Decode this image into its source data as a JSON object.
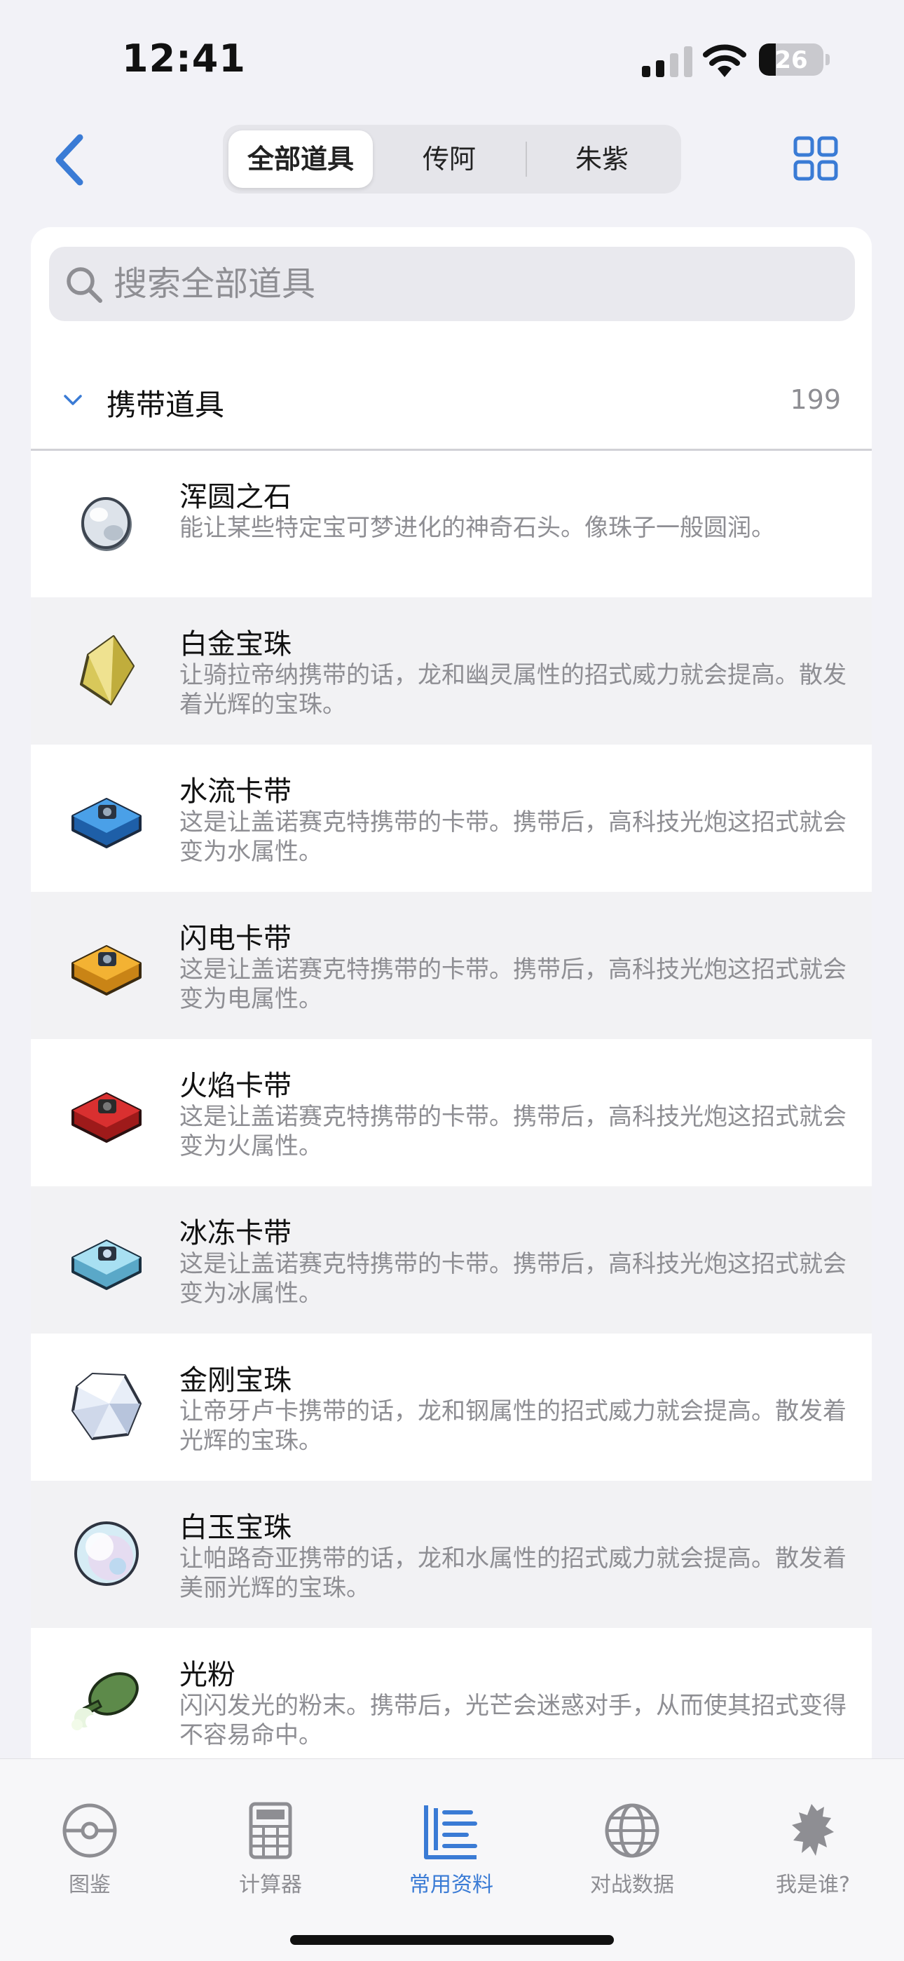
{
  "status_bar": {
    "time": "12:41",
    "battery": "26",
    "battery_level": 0.26
  },
  "nav": {
    "segments": [
      {
        "label": "全部道具",
        "active": true
      },
      {
        "label": "传阿",
        "active": false
      },
      {
        "label": "朱紫",
        "active": false
      }
    ]
  },
  "search": {
    "placeholder": "搜索全部道具",
    "value": ""
  },
  "section": {
    "title": "携带道具",
    "count": "199"
  },
  "items": [
    {
      "name": "浑圆之石",
      "desc": "能让某些特定宝可梦进化的神奇石头。像珠子一般圆润。",
      "icon": "oval-stone-icon"
    },
    {
      "name": "白金宝珠",
      "desc": "让骑拉帝纳携带的话，龙和幽灵属性的招式威力就会提高。散发着光辉的宝珠。",
      "icon": "griseous-orb-icon"
    },
    {
      "name": "水流卡带",
      "desc": "这是让盖诺赛克特携带的卡带。携带后，高科技光炮这招式就会变为水属性。",
      "icon": "douse-drive-icon"
    },
    {
      "name": "闪电卡带",
      "desc": "这是让盖诺赛克特携带的卡带。携带后，高科技光炮这招式就会变为电属性。",
      "icon": "shock-drive-icon"
    },
    {
      "name": "火焰卡带",
      "desc": "这是让盖诺赛克特携带的卡带。携带后，高科技光炮这招式就会变为火属性。",
      "icon": "burn-drive-icon"
    },
    {
      "name": "冰冻卡带",
      "desc": "这是让盖诺赛克特携带的卡带。携带后，高科技光炮这招式就会变为冰属性。",
      "icon": "chill-drive-icon"
    },
    {
      "name": "金刚宝珠",
      "desc": "让帝牙卢卡携带的话，龙和钢属性的招式威力就会提高。散发着光辉的宝珠。",
      "icon": "adamant-orb-icon"
    },
    {
      "name": "白玉宝珠",
      "desc": "让帕路奇亚携带的话，龙和水属性的招式威力就会提高。散发着美丽光辉的宝珠。",
      "icon": "lustrous-orb-icon"
    },
    {
      "name": "光粉",
      "desc": "闪闪发光的粉末。携带后，光芒会迷惑对手，从而使其招式变得不容易命中。",
      "icon": "bright-powder-icon"
    }
  ],
  "tabs": [
    {
      "label": "图鉴",
      "active": false
    },
    {
      "label": "计算器",
      "active": false
    },
    {
      "label": "常用资料",
      "active": true
    },
    {
      "label": "对战数据",
      "active": false
    },
    {
      "label": "我是谁?",
      "active": false
    }
  ],
  "colors": {
    "accent": "#3a7bd5",
    "secondary_text": "#8e8e93"
  }
}
